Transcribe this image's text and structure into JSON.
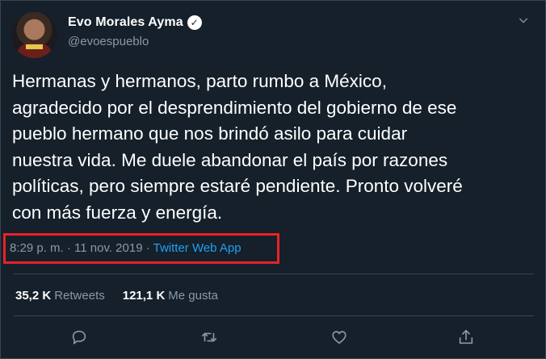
{
  "author": {
    "name": "Evo Morales Ayma",
    "handle": "@evoespueblo",
    "verified_glyph": "✓"
  },
  "tweet": {
    "text": "Hermanas y hermanos, parto rumbo a México,\nagradecido por el desprendimiento del gobierno de ese\npueblo hermano que nos brindó asilo para cuidar\nnuestra vida. Me duele abandonar el país por razones\npolíticas, pero siempre estaré pendiente. Pronto volveré\ncon más fuerza y energía.",
    "timestamp": "8:29 p. m. · 11 nov. 2019 · ",
    "source": "Twitter Web App"
  },
  "stats": {
    "retweets_count": "35,2 K",
    "retweets_label": "Retweets",
    "likes_count": "121,1 K",
    "likes_label": "Me gusta"
  },
  "icons": {
    "reply": "reply-icon",
    "retweet": "retweet-icon",
    "like": "like-icon",
    "share": "share-icon",
    "menu": "chevron-down-icon"
  },
  "colors": {
    "background": "#15202b",
    "secondary_text": "#8899a6",
    "link": "#1da1f2",
    "highlight_box": "#e8222b"
  }
}
